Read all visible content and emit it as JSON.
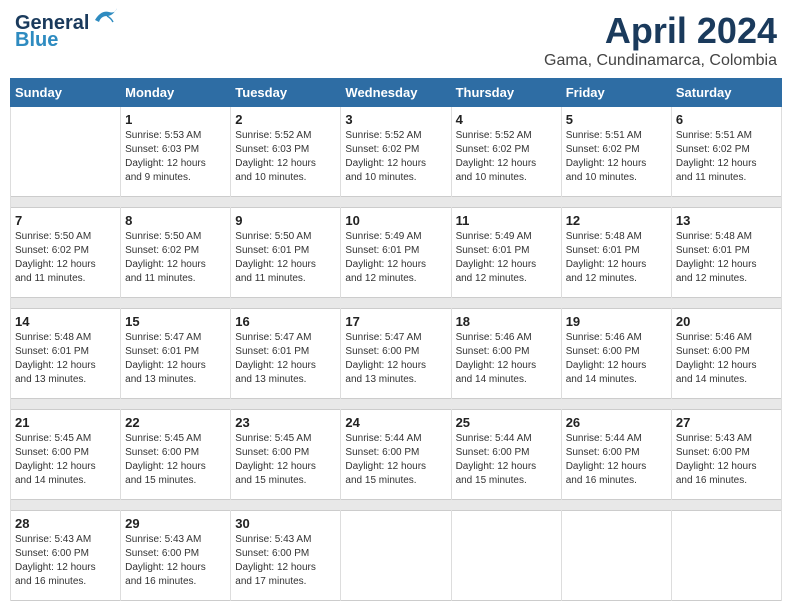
{
  "header": {
    "logo_line1": "General",
    "logo_line2": "Blue",
    "month": "April 2024",
    "location": "Gama, Cundinamarca, Colombia"
  },
  "weekdays": [
    "Sunday",
    "Monday",
    "Tuesday",
    "Wednesday",
    "Thursday",
    "Friday",
    "Saturday"
  ],
  "weeks": [
    [
      {
        "day": "",
        "info": ""
      },
      {
        "day": "1",
        "info": "Sunrise: 5:53 AM\nSunset: 6:03 PM\nDaylight: 12 hours\nand 9 minutes."
      },
      {
        "day": "2",
        "info": "Sunrise: 5:52 AM\nSunset: 6:03 PM\nDaylight: 12 hours\nand 10 minutes."
      },
      {
        "day": "3",
        "info": "Sunrise: 5:52 AM\nSunset: 6:02 PM\nDaylight: 12 hours\nand 10 minutes."
      },
      {
        "day": "4",
        "info": "Sunrise: 5:52 AM\nSunset: 6:02 PM\nDaylight: 12 hours\nand 10 minutes."
      },
      {
        "day": "5",
        "info": "Sunrise: 5:51 AM\nSunset: 6:02 PM\nDaylight: 12 hours\nand 10 minutes."
      },
      {
        "day": "6",
        "info": "Sunrise: 5:51 AM\nSunset: 6:02 PM\nDaylight: 12 hours\nand 11 minutes."
      }
    ],
    [
      {
        "day": "7",
        "info": "Sunrise: 5:50 AM\nSunset: 6:02 PM\nDaylight: 12 hours\nand 11 minutes."
      },
      {
        "day": "8",
        "info": "Sunrise: 5:50 AM\nSunset: 6:02 PM\nDaylight: 12 hours\nand 11 minutes."
      },
      {
        "day": "9",
        "info": "Sunrise: 5:50 AM\nSunset: 6:01 PM\nDaylight: 12 hours\nand 11 minutes."
      },
      {
        "day": "10",
        "info": "Sunrise: 5:49 AM\nSunset: 6:01 PM\nDaylight: 12 hours\nand 12 minutes."
      },
      {
        "day": "11",
        "info": "Sunrise: 5:49 AM\nSunset: 6:01 PM\nDaylight: 12 hours\nand 12 minutes."
      },
      {
        "day": "12",
        "info": "Sunrise: 5:48 AM\nSunset: 6:01 PM\nDaylight: 12 hours\nand 12 minutes."
      },
      {
        "day": "13",
        "info": "Sunrise: 5:48 AM\nSunset: 6:01 PM\nDaylight: 12 hours\nand 12 minutes."
      }
    ],
    [
      {
        "day": "14",
        "info": "Sunrise: 5:48 AM\nSunset: 6:01 PM\nDaylight: 12 hours\nand 13 minutes."
      },
      {
        "day": "15",
        "info": "Sunrise: 5:47 AM\nSunset: 6:01 PM\nDaylight: 12 hours\nand 13 minutes."
      },
      {
        "day": "16",
        "info": "Sunrise: 5:47 AM\nSunset: 6:01 PM\nDaylight: 12 hours\nand 13 minutes."
      },
      {
        "day": "17",
        "info": "Sunrise: 5:47 AM\nSunset: 6:00 PM\nDaylight: 12 hours\nand 13 minutes."
      },
      {
        "day": "18",
        "info": "Sunrise: 5:46 AM\nSunset: 6:00 PM\nDaylight: 12 hours\nand 14 minutes."
      },
      {
        "day": "19",
        "info": "Sunrise: 5:46 AM\nSunset: 6:00 PM\nDaylight: 12 hours\nand 14 minutes."
      },
      {
        "day": "20",
        "info": "Sunrise: 5:46 AM\nSunset: 6:00 PM\nDaylight: 12 hours\nand 14 minutes."
      }
    ],
    [
      {
        "day": "21",
        "info": "Sunrise: 5:45 AM\nSunset: 6:00 PM\nDaylight: 12 hours\nand 14 minutes."
      },
      {
        "day": "22",
        "info": "Sunrise: 5:45 AM\nSunset: 6:00 PM\nDaylight: 12 hours\nand 15 minutes."
      },
      {
        "day": "23",
        "info": "Sunrise: 5:45 AM\nSunset: 6:00 PM\nDaylight: 12 hours\nand 15 minutes."
      },
      {
        "day": "24",
        "info": "Sunrise: 5:44 AM\nSunset: 6:00 PM\nDaylight: 12 hours\nand 15 minutes."
      },
      {
        "day": "25",
        "info": "Sunrise: 5:44 AM\nSunset: 6:00 PM\nDaylight: 12 hours\nand 15 minutes."
      },
      {
        "day": "26",
        "info": "Sunrise: 5:44 AM\nSunset: 6:00 PM\nDaylight: 12 hours\nand 16 minutes."
      },
      {
        "day": "27",
        "info": "Sunrise: 5:43 AM\nSunset: 6:00 PM\nDaylight: 12 hours\nand 16 minutes."
      }
    ],
    [
      {
        "day": "28",
        "info": "Sunrise: 5:43 AM\nSunset: 6:00 PM\nDaylight: 12 hours\nand 16 minutes."
      },
      {
        "day": "29",
        "info": "Sunrise: 5:43 AM\nSunset: 6:00 PM\nDaylight: 12 hours\nand 16 minutes."
      },
      {
        "day": "30",
        "info": "Sunrise: 5:43 AM\nSunset: 6:00 PM\nDaylight: 12 hours\nand 17 minutes."
      },
      {
        "day": "",
        "info": ""
      },
      {
        "day": "",
        "info": ""
      },
      {
        "day": "",
        "info": ""
      },
      {
        "day": "",
        "info": ""
      }
    ]
  ]
}
